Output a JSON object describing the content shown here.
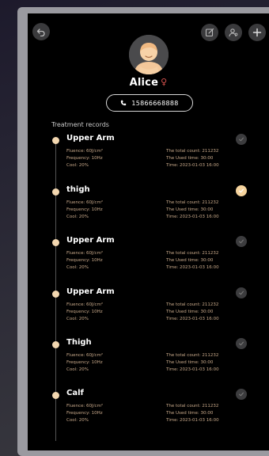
{
  "patient": {
    "name": "Alice",
    "phone": "15866668888"
  },
  "section_title": "Treatment records",
  "colors": {
    "accent": "#f3d7b0",
    "checked": "#f6d49e",
    "detail_text": "#c8a98a",
    "gender": "#d9534f"
  },
  "icons": {
    "back": "undo-icon",
    "edit": "edit-icon",
    "user": "user-settings-icon",
    "add": "plus-icon"
  },
  "records": [
    {
      "area": "Upper Arm",
      "fluence": "Fluence: 60J/cm²",
      "frequency": "Frequency: 10Hz",
      "cool": "Cool: 20%",
      "total": "The total count: 211232",
      "used": "The Used time: 30:00",
      "time": "Time: 2023-01-03 16:00",
      "checked": false
    },
    {
      "area": "thigh",
      "fluence": "Fluence: 60J/cm²",
      "frequency": "Frequency: 10Hz",
      "cool": "Cool: 20%",
      "total": "The total count: 211232",
      "used": "The Used time: 30:00",
      "time": "Time: 2023-01-03 16:00",
      "checked": true
    },
    {
      "area": "Upper Arm",
      "fluence": "Fluence: 60J/cm²",
      "frequency": "Frequency: 10Hz",
      "cool": "Cool: 20%",
      "total": "The total count: 211232",
      "used": "The Used time: 30:00",
      "time": "Time: 2023-01-03 16:00",
      "checked": false
    },
    {
      "area": "Upper Arm",
      "fluence": "Fluence: 60J/cm²",
      "frequency": "Frequency: 10Hz",
      "cool": "Cool: 20%",
      "total": "The total count: 211232",
      "used": "The Used time: 30:00",
      "time": "Time: 2023-01-03 16:00",
      "checked": false
    },
    {
      "area": "Thigh",
      "fluence": "Fluence: 60J/cm²",
      "frequency": "Frequency: 10Hz",
      "cool": "Cool: 20%",
      "total": "The total count: 211232",
      "used": "The Used time: 30:00",
      "time": "Time: 2023-01-03 16:00",
      "checked": false
    },
    {
      "area": "Calf",
      "fluence": "Fluence: 60J/cm²",
      "frequency": "Frequency: 10Hz",
      "cool": "Cool: 20%",
      "total": "The total count: 211232",
      "used": "The Used time: 30:00",
      "time": "Time: 2023-01-03 16:00",
      "checked": false
    }
  ]
}
